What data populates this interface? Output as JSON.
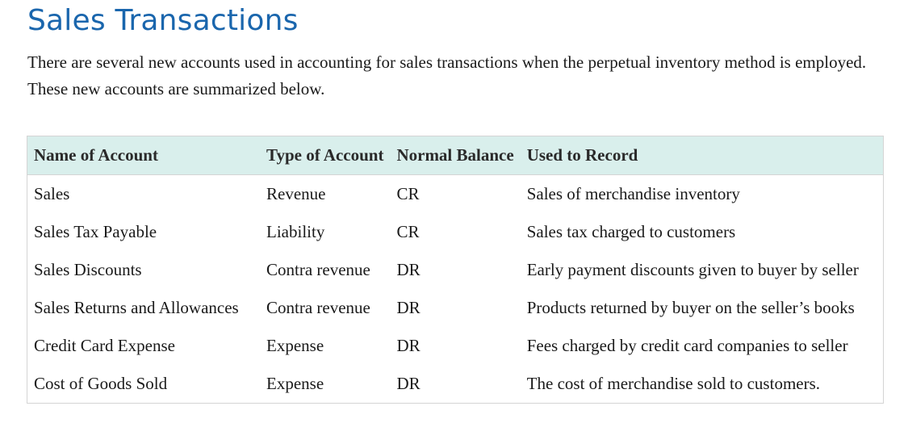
{
  "page": {
    "title": "Sales Transactions",
    "intro": "There are several new accounts used in accounting for sales transactions when the perpetual inventory method is employed. These new accounts are summarized below."
  },
  "table": {
    "headers": [
      "Name of Account",
      "Type of Account",
      "Normal Balance",
      "Used to Record"
    ],
    "rows": [
      [
        "Sales",
        "Revenue",
        "CR",
        "Sales of merchandise inventory"
      ],
      [
        "Sales Tax Payable",
        "Liability",
        "CR",
        "Sales tax charged to customers"
      ],
      [
        "Sales Discounts",
        "Contra revenue",
        "DR",
        "Early payment discounts given to buyer by seller"
      ],
      [
        "Sales Returns and Allowances",
        "Contra revenue",
        "DR",
        "Products returned by buyer on the seller’s books"
      ],
      [
        "Credit Card Expense",
        "Expense",
        "DR",
        "Fees charged by credit card companies to seller"
      ],
      [
        "Cost of Goods Sold",
        "Expense",
        "DR",
        "The cost of merchandise sold to customers."
      ]
    ]
  },
  "colors": {
    "title": "#1a66ad",
    "header_bg": "#d9efec",
    "border": "#d4d4d4"
  }
}
